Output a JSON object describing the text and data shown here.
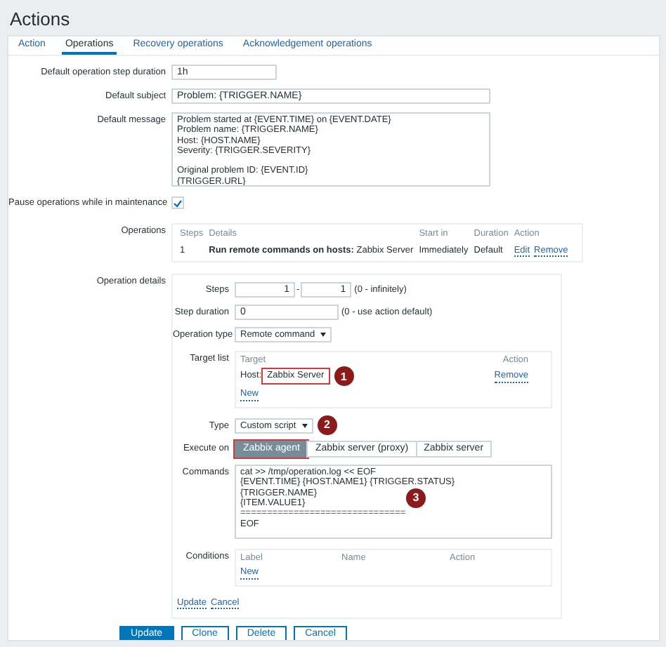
{
  "page": {
    "title": "Actions"
  },
  "tabs": [
    {
      "label": "Action",
      "selected": false
    },
    {
      "label": "Operations",
      "selected": true
    },
    {
      "label": "Recovery operations",
      "selected": false
    },
    {
      "label": "Acknowledgement operations",
      "selected": false
    }
  ],
  "fields": [
    {
      "kind": "short",
      "label": "Default operation step duration",
      "value": "1h"
    },
    {
      "kind": "wide",
      "label": "Default subject",
      "value": "Problem: {TRIGGER.NAME}"
    },
    {
      "kind": "textarea",
      "label": "Default message",
      "value": "Problem started at {EVENT.TIME} on {EVENT.DATE}\nProblem name: {TRIGGER.NAME}\nHost: {HOST.NAME}\nSeverity: {TRIGGER.SEVERITY}\n\nOriginal problem ID: {EVENT.ID}\n{TRIGGER.URL}"
    },
    {
      "kind": "checkbox",
      "label": "Pause operations while in maintenance",
      "checked": true
    }
  ],
  "operations": {
    "label": "Operations",
    "columns": [
      "Steps",
      "Details",
      "Start in",
      "Duration",
      "Action"
    ],
    "rows": [
      {
        "steps": "1",
        "details": "**Run remote commands on hosts:** Zabbix Server",
        "start_in": "Immediately",
        "duration": "Default",
        "actions": [
          "Edit",
          "Remove"
        ]
      }
    ]
  },
  "operation_details": {
    "label": "Operation details",
    "steps": {
      "label": "Steps",
      "from": "1",
      "separator": "-",
      "to": "1",
      "hint": "(0 - infinitely)"
    },
    "step_duration": {
      "label": "Step duration",
      "value": "0",
      "hint": "(0 - use action default)"
    },
    "operation_type": {
      "label": "Operation type",
      "value": "Remote command"
    },
    "target_list": {
      "label": "Target list",
      "columns": [
        "Target",
        "Action"
      ],
      "rows": [
        {
          "prefix": "Host:",
          "target": "Zabbix Server",
          "highlighted": true,
          "marker": "1",
          "action": "Remove"
        }
      ],
      "new_link": "New"
    },
    "type": {
      "label": "Type",
      "value": "Custom script",
      "marker": "2"
    },
    "execute_on": {
      "label": "Execute on",
      "options": [
        {
          "label": "Zabbix agent",
          "selected": true,
          "highlighted": true
        },
        {
          "label": "Zabbix server (proxy)",
          "selected": false,
          "highlighted": false
        },
        {
          "label": "Zabbix server",
          "selected": false,
          "highlighted": false
        }
      ]
    },
    "commands": {
      "label": "Commands",
      "value": "cat >> /tmp/operation.log << EOF\n{EVENT.TIME} {HOST.NAME1} {TRIGGER.STATUS}\n{TRIGGER.NAME}\n{ITEM.VALUE1}\n===============================\nEOF",
      "marker": "3"
    },
    "conditions": {
      "label": "Conditions",
      "columns": [
        "Label",
        "Name",
        "Action"
      ],
      "new_link": "New"
    },
    "links": [
      "Update",
      "Cancel"
    ]
  },
  "buttons": [
    {
      "label": "Update",
      "primary": true
    },
    {
      "label": "Clone",
      "primary": false
    },
    {
      "label": "Delete",
      "primary": false
    },
    {
      "label": "Cancel",
      "primary": false
    }
  ]
}
